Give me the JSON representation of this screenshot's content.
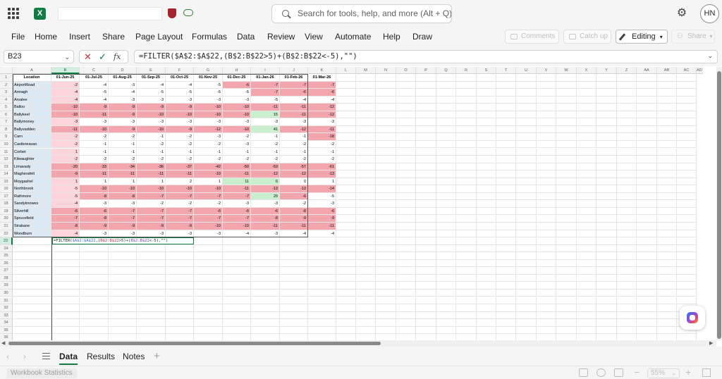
{
  "app": {
    "logo_text": "X",
    "search_placeholder": "Search for tools, help, and more (Alt + Q)",
    "user_initials": "HN"
  },
  "menu": {
    "items": [
      "File",
      "Home",
      "Insert",
      "Share",
      "Page Layout",
      "Formulas",
      "Data",
      "Review",
      "View",
      "Automate",
      "Help",
      "Draw"
    ],
    "comments": "Comments",
    "catch_up": "Catch up",
    "editing": "Editing",
    "share": "Share"
  },
  "formula_bar": {
    "name_box": "B23",
    "fx": "fx",
    "formula": "=FILTER($A$2:$A$22,(B$2:B$22>5)+(B$2:B$22<-5),\"\")"
  },
  "grid": {
    "column_letters": [
      "A",
      "B",
      "C",
      "D",
      "E",
      "F",
      "G",
      "H",
      "I",
      "J",
      "K",
      "L",
      "M",
      "N",
      "O",
      "P",
      "Q",
      "R",
      "S",
      "T",
      "U",
      "V",
      "W",
      "X",
      "Y",
      "Z",
      "AA",
      "AB",
      "AC",
      "AD"
    ],
    "header_row": [
      "Location",
      "01-Jun-25",
      "01-Jul-25",
      "01-Aug-25",
      "01-Sep-25",
      "01-Oct-25",
      "01-Nov-25",
      "01-Dec-25",
      "01-Jan-26",
      "01-Feb-26",
      "01-Mar-26"
    ],
    "rows": [
      {
        "loc": "AirportRoad",
        "vals": [
          -2,
          -4,
          -3,
          -4,
          -4,
          -5,
          -6,
          -7,
          -7,
          -7
        ]
      },
      {
        "loc": "Armagh",
        "vals": [
          -4,
          -5,
          -4,
          -5,
          -5,
          -5,
          -5,
          -7,
          -6,
          -6
        ]
      },
      {
        "loc": "Arvalee",
        "vals": [
          -4,
          -4,
          -3,
          -3,
          -3,
          -3,
          -3,
          -5,
          -4,
          -4
        ]
      },
      {
        "loc": "Balloo",
        "vals": [
          -10,
          -9,
          -9,
          -9,
          -9,
          -10,
          -10,
          -11,
          -11,
          -12
        ]
      },
      {
        "loc": "Ballykeel",
        "vals": [
          -10,
          -11,
          -9,
          -10,
          -10,
          -10,
          -10,
          15,
          -11,
          -12
        ]
      },
      {
        "loc": "Ballymoney",
        "vals": [
          -3,
          -3,
          -3,
          -3,
          -3,
          -3,
          -3,
          -3,
          -3,
          -3
        ]
      },
      {
        "loc": "Ballyvadden",
        "vals": [
          -11,
          -10,
          -9,
          -10,
          -9,
          -12,
          -10,
          41,
          -12,
          -11
        ]
      },
      {
        "loc": "Carn",
        "vals": [
          -2,
          -2,
          -2,
          -1,
          -2,
          -3,
          -2,
          -1,
          -1,
          -18
        ]
      },
      {
        "loc": "Castlereavan",
        "vals": [
          -2,
          -1,
          -1,
          -2,
          -2,
          -2,
          -3,
          -2,
          -2,
          -2
        ]
      },
      {
        "loc": "Corbet",
        "vals": [
          1,
          -1,
          -1,
          -1,
          -1,
          -1,
          -1,
          -1,
          -1,
          -1
        ]
      },
      {
        "loc": "Kilwaughter",
        "vals": [
          -2,
          -2,
          -2,
          -2,
          -2,
          -2,
          -2,
          -2,
          -2,
          -2
        ]
      },
      {
        "loc": "Limavady",
        "vals": [
          -20,
          -33,
          -34,
          -36,
          -37,
          -42,
          -50,
          -53,
          -57,
          -61
        ]
      },
      {
        "loc": "Magherafelt",
        "vals": [
          -9,
          -11,
          -11,
          -11,
          -11,
          -10,
          -11,
          -12,
          -12,
          -13
        ]
      },
      {
        "loc": "Moygashel",
        "vals": [
          1,
          1,
          1,
          1,
          2,
          1,
          11,
          6,
          0,
          1
        ]
      },
      {
        "loc": "Northbrook",
        "vals": [
          -5,
          -10,
          -10,
          -10,
          -10,
          -10,
          -11,
          -13,
          -13,
          -14
        ]
      },
      {
        "loc": "Rathmore",
        "vals": [
          -5,
          -8,
          -8,
          -7,
          -7,
          -7,
          -7,
          29,
          -6,
          -5
        ]
      },
      {
        "loc": "Sandyknowes",
        "vals": [
          -4,
          -3,
          -3,
          -2,
          -2,
          -2,
          -3,
          -3,
          -2,
          -3
        ]
      },
      {
        "loc": "Silverhill",
        "vals": [
          -6,
          -6,
          -7,
          -7,
          -7,
          -6,
          -6,
          -6,
          -8,
          -6
        ]
      },
      {
        "loc": "Sprucefield",
        "vals": [
          -7,
          -8,
          -7,
          -7,
          -7,
          -7,
          -7,
          -8,
          -9,
          -9
        ]
      },
      {
        "loc": "Strabane",
        "vals": [
          -8,
          -9,
          -9,
          -9,
          -9,
          -10,
          -10,
          -11,
          -11,
          -11
        ]
      },
      {
        "loc": "Woodburn",
        "vals": [
          -4,
          -3,
          -3,
          -3,
          -3,
          -3,
          -4,
          -3,
          -4,
          -4
        ]
      }
    ],
    "edit_cell": {
      "prefix": "=FILTER(",
      "ref1": "$A$2:$A$22",
      "mid1": ",(",
      "ref2": "B$2:B$22",
      "mid2": ">5)+(",
      "ref3": "B$2:B$22",
      "suffix": "<-5),\"\")"
    },
    "colors": {
      "neg_strong": "#f4a6ae",
      "neg_light": "#fbd5da",
      "pos": "#c9efcf"
    }
  },
  "sheets": {
    "tabs": [
      "Data",
      "Results",
      "Notes"
    ],
    "active": "Data"
  },
  "status": {
    "workbook_stats": "Workbook Statistics",
    "zoom": "55%"
  }
}
